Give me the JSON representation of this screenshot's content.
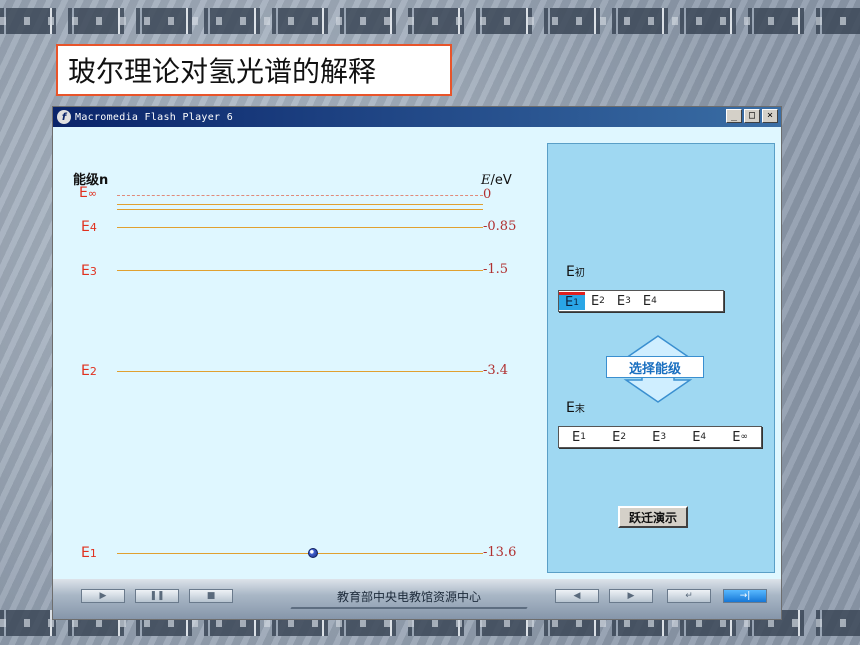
{
  "slide": {
    "title": "玻尔理论对氢光谱的解释"
  },
  "window": {
    "title": "Macromedia Flash Player 6",
    "minimize_label": "_",
    "maximize_label": "□",
    "close_label": "×"
  },
  "diagram": {
    "level_axis_label": "能级n",
    "energy_axis_label_italic": "E",
    "energy_axis_label_unit": "/eV",
    "levels": [
      {
        "label": "E",
        "sub": "∞",
        "value": "0"
      },
      {
        "label": "E",
        "sub": "4",
        "value": "-0.85"
      },
      {
        "label": "E",
        "sub": "3",
        "value": "-1.5"
      },
      {
        "label": "E",
        "sub": "2",
        "value": "-3.4"
      },
      {
        "label": "E",
        "sub": "1",
        "value": "-13.6"
      }
    ]
  },
  "initial_selector": {
    "label": "E",
    "label_sub": "初",
    "options": [
      {
        "label": "E",
        "sub": "1"
      },
      {
        "label": "E",
        "sub": "2"
      },
      {
        "label": "E",
        "sub": "3"
      },
      {
        "label": "E",
        "sub": "4"
      }
    ],
    "selected": "E1"
  },
  "choose_button": "选择能级",
  "final_selector": {
    "label": "E",
    "label_sub": "末",
    "options": [
      {
        "label": "E",
        "sub": "1"
      },
      {
        "label": "E",
        "sub": "2"
      },
      {
        "label": "E",
        "sub": "3"
      },
      {
        "label": "E",
        "sub": "4"
      },
      {
        "label": "E",
        "sub": "∞"
      }
    ]
  },
  "demo_button": "跃迁演示",
  "controls": {
    "play": "▶",
    "pause": "❚❚",
    "stop": "■",
    "center_title": "教育部中央电教馆资源中心",
    "back": "◀",
    "forward": "▶",
    "return": "↵",
    "exit": "→|"
  }
}
